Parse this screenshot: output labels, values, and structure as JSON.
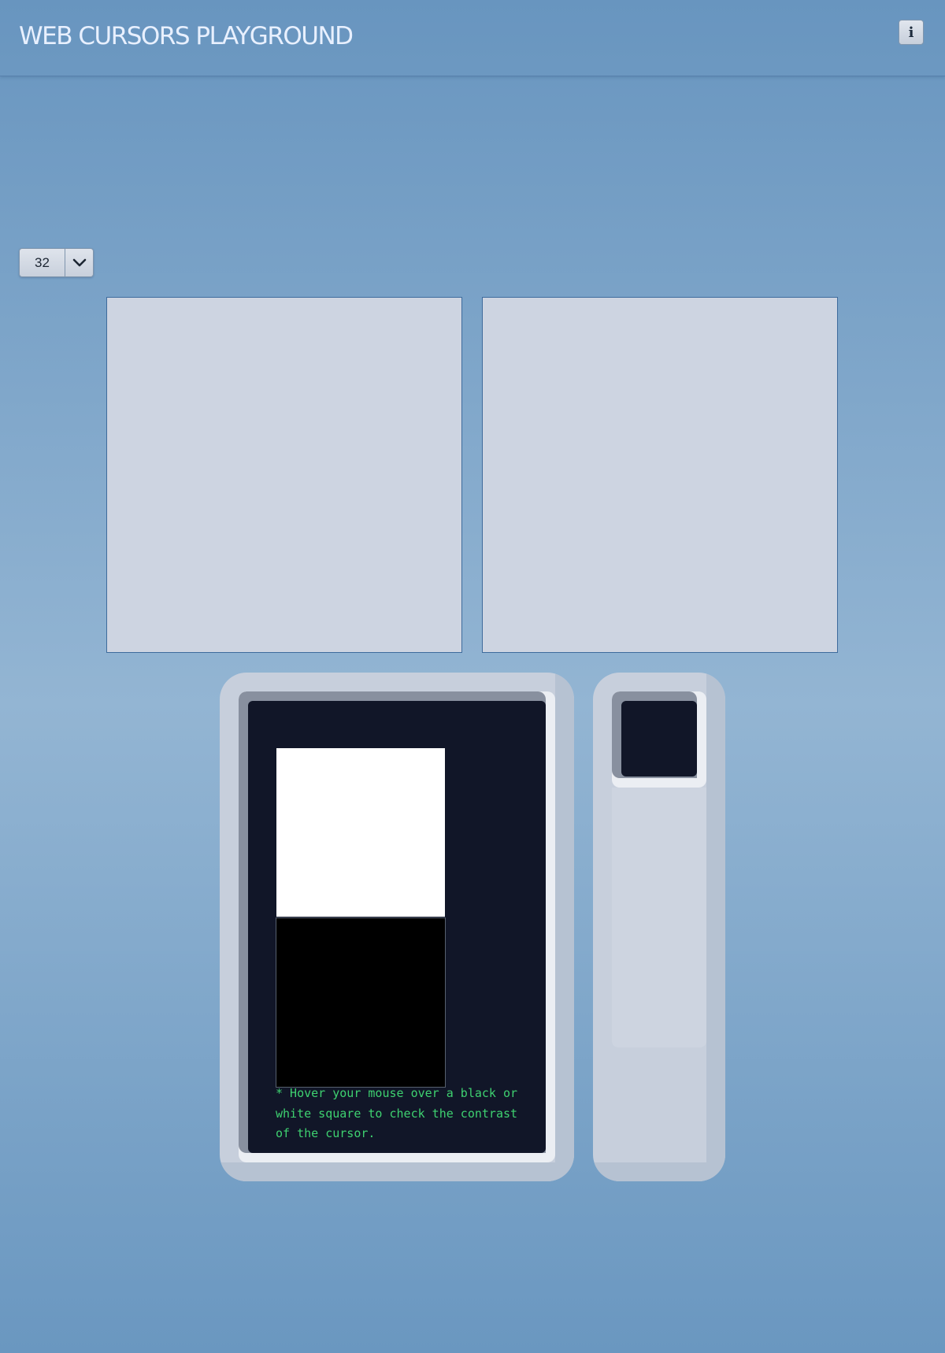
{
  "header": {
    "title": "WEB CURSORS PLAYGROUND",
    "info_button_label": "i"
  },
  "size_select": {
    "value": "32",
    "dropdown_icon": "chevron-down-icon"
  },
  "panels": [
    {
      "name": "preview-panel-left"
    },
    {
      "name": "preview-panel-right"
    }
  ],
  "contrast_test": {
    "note": "* Hover your mouse over a black or white square to check the contrast of the cursor."
  },
  "colors": {
    "background_top": "#6895bf",
    "background_mid": "#93b5d3",
    "panel": "#cdd4e1",
    "screen": "#111628",
    "note_text": "#3ed170"
  }
}
